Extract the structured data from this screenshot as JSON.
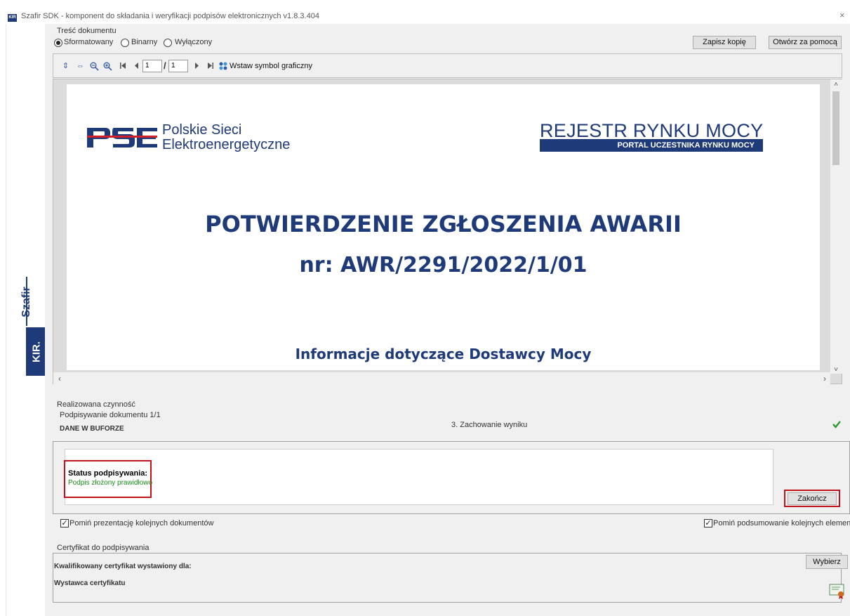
{
  "window": {
    "title": "Szafir SDK - komponent do składania i weryfikacji podpisów elektronicznych v1.8.3.404",
    "app_icon_text": "KIR",
    "close_glyph": "×"
  },
  "brand": {
    "product": "Szafir",
    "vendor": "KIR."
  },
  "document_content": {
    "group_label": "Treść dokumentu",
    "radios": [
      {
        "label": "Sformatowany",
        "selected": true
      },
      {
        "label": "Binarny",
        "selected": false
      },
      {
        "label": "Wyłączony",
        "selected": false
      }
    ],
    "save_copy_button": "Zapisz kopię",
    "open_with_button": "Otwórz za pomocą"
  },
  "toolbar": {
    "page_current": "1",
    "page_total": "1",
    "page_separator": "/",
    "insert_symbol_label": "Wstaw symbol graficzny"
  },
  "document": {
    "pse_line1": "Polskie Sieci",
    "pse_line2": "Elektroenergetyczne",
    "registry_title": "REJESTR RYNKU MOCY",
    "registry_subtitle": "PORTAL UCZESTNIKA RYNKU MOCY",
    "heading": "POTWIERDZENIE ZGŁOSZENIA AWARII",
    "number": "nr: AWR/2291/2022/1/01",
    "section": "Informacje dotyczące Dostawcy Mocy"
  },
  "activity": {
    "group_label": "Realizowana czynność",
    "signing_doc": "Podpisywanie dokumentu 1/1",
    "buffer": "DANE W BUFORZE",
    "step": "3. Zachowanie wyniku",
    "status_color": "#2a9b2a"
  },
  "status": {
    "label": "Status podpisywania:",
    "value": "Podpis złożony prawidłowo",
    "value_color": "#1a8a1a",
    "finish_button": "Zakończ",
    "highlight_color": "#c0131b"
  },
  "options": {
    "skip_presentation": "Pomiń prezentację kolejnych dokumentów",
    "skip_summary": "Pomiń podsumowanie kolejnych elementów"
  },
  "certificate": {
    "group_label": "Certyfikat do podpisywania",
    "issued_for": "Kwalifikowany certyfikat wystawiony dla:",
    "issuer": "Wystawca certyfikatu",
    "select_button": "Wybierz"
  },
  "colors": {
    "brand_navy": "#1e3a78"
  }
}
